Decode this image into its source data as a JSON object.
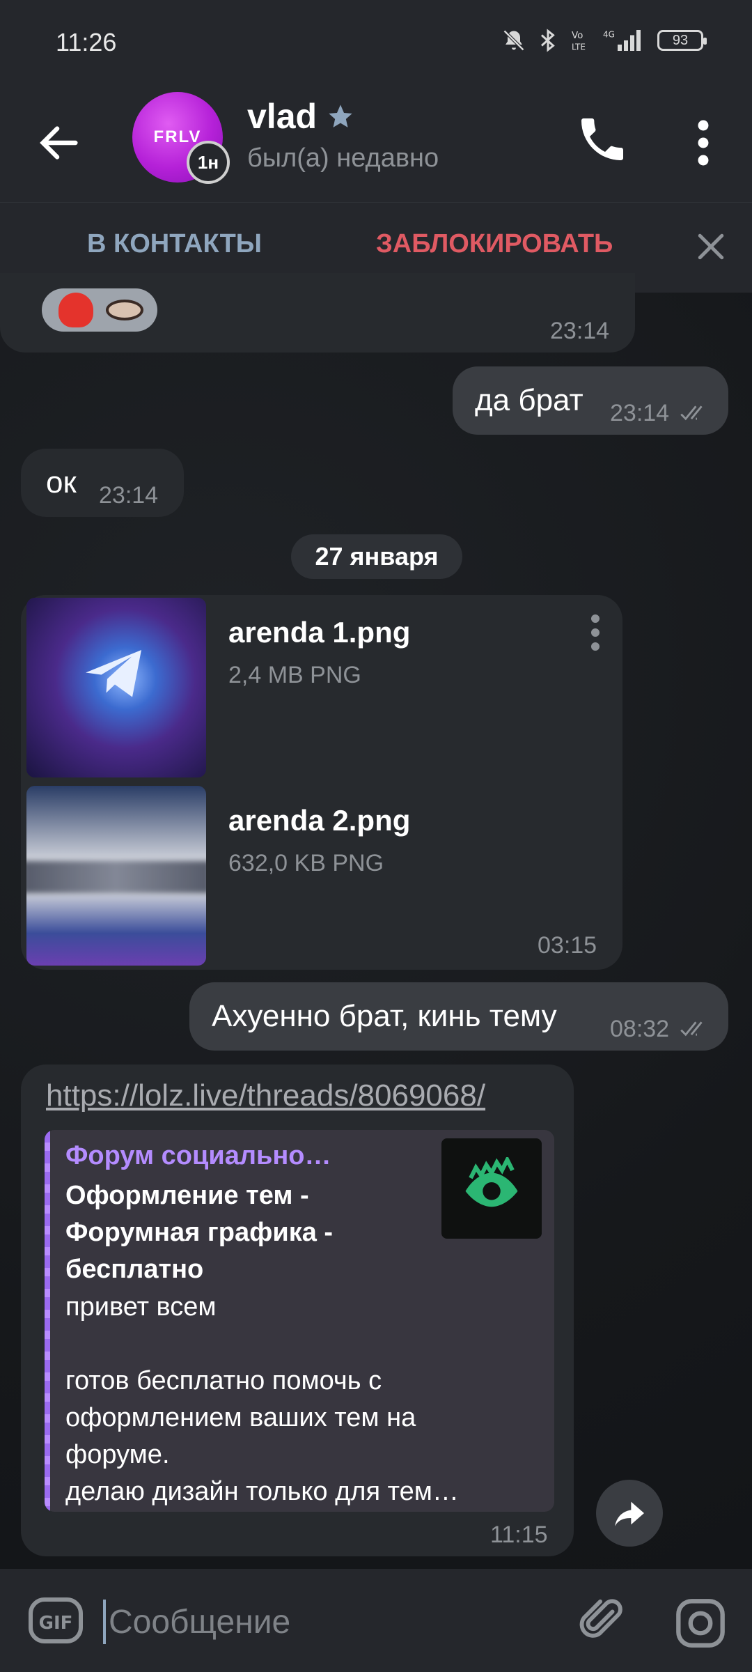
{
  "status_bar": {
    "time": "11:26",
    "battery": "93",
    "network": "4G"
  },
  "header": {
    "avatar_text": "FRLV",
    "story_badge": "1н",
    "name": "vlad",
    "status": "был(а) недавно"
  },
  "action_bar": {
    "add_contact": "В КОНТАКТЫ",
    "block": "ЗАБЛОКИРОВАТЬ"
  },
  "messages": {
    "m1_time": "23:14",
    "m2_text": "да брат",
    "m2_time": "23:14",
    "m3_text": "ок",
    "m3_time": "23:14",
    "date": "27 января",
    "file1_name": "arenda 1.png",
    "file1_meta": "2,4 MB PNG",
    "file2_name": "arenda 2.png",
    "file2_meta": "632,0 KB PNG",
    "files_time": "03:15",
    "m5_text": "Ахуенно брат, кинь тему",
    "m5_time": "08:32",
    "link_url": "https://lolz.live/threads/8069068/",
    "preview_site": "Форум социально…",
    "preview_title": "Оформление тем - Форумная графика - бесплатно",
    "preview_line1": "привет всем",
    "preview_line2": "",
    "preview_line3": "готов бесплатно помочь с",
    "preview_line4": "оформлением ваших тем на",
    "preview_line5": "форуме.",
    "preview_line6": "делаю дизайн только для тем…",
    "link_time": "11:15"
  },
  "input": {
    "placeholder": "Сообщение",
    "gif_label": "GIF"
  },
  "colors": {
    "accent": "#8fa6be",
    "danger": "#e05a63",
    "preview_accent": "#b48cff"
  }
}
